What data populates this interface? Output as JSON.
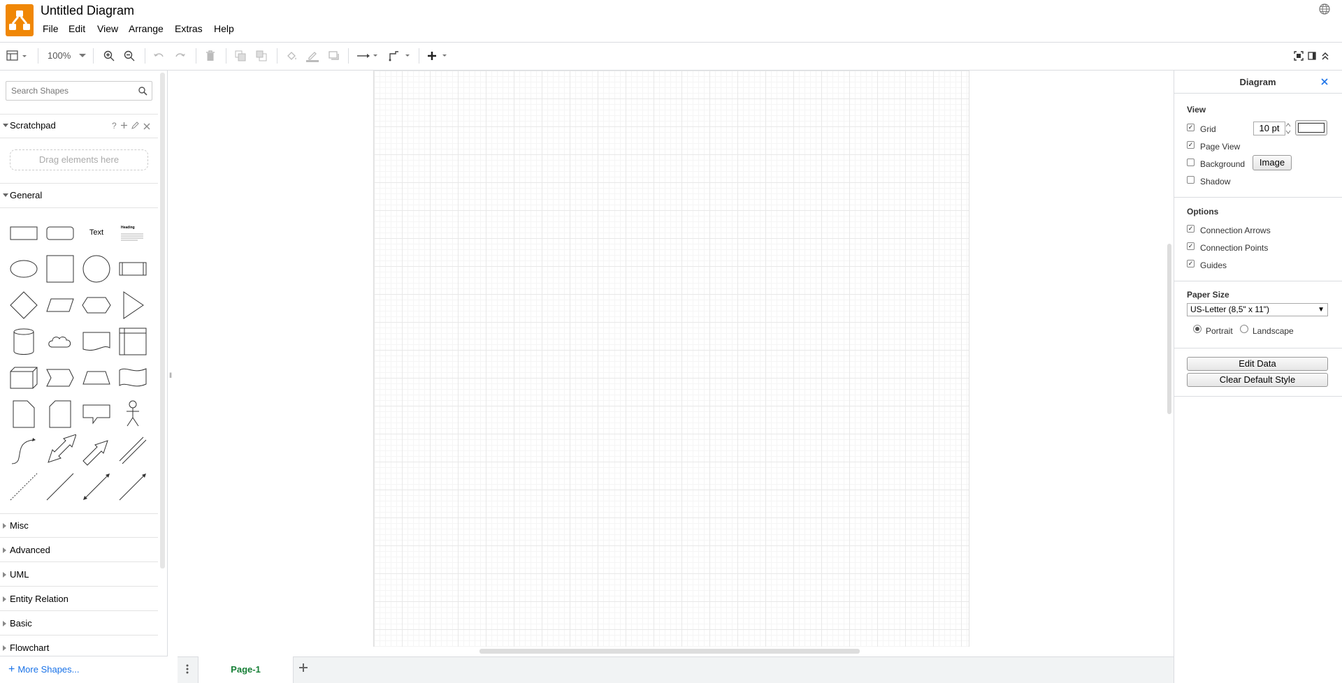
{
  "app": {
    "title": "Untitled Diagram",
    "menu": [
      "File",
      "Edit",
      "View",
      "Arrange",
      "Extras",
      "Help"
    ]
  },
  "toolbar": {
    "zoom": "100%"
  },
  "sidebar": {
    "search_placeholder": "Search Shapes",
    "scratchpad": {
      "label": "Scratchpad",
      "help": "?",
      "drag_hint": "Drag elements here"
    },
    "general_label": "General",
    "shape_text": "Text",
    "shape_heading": "Heading",
    "collapsed_sections": [
      "Misc",
      "Advanced",
      "UML",
      "Entity Relation",
      "Basic",
      "Flowchart"
    ],
    "more_shapes": "More Shapes..."
  },
  "pages": {
    "tabs": [
      "Page-1"
    ]
  },
  "panel": {
    "title": "Diagram",
    "view": {
      "heading": "View",
      "grid_label": "Grid",
      "grid_checked": true,
      "grid_size": "10 pt",
      "page_view_label": "Page View",
      "page_view_checked": true,
      "background_label": "Background",
      "background_checked": false,
      "image_button": "Image",
      "shadow_label": "Shadow",
      "shadow_checked": false
    },
    "options": {
      "heading": "Options",
      "items": [
        {
          "label": "Connection Arrows",
          "checked": true
        },
        {
          "label": "Connection Points",
          "checked": true
        },
        {
          "label": "Guides",
          "checked": true
        }
      ]
    },
    "paper": {
      "heading": "Paper Size",
      "selected": "US-Letter (8,5\" x 11\")",
      "portrait_label": "Portrait",
      "landscape_label": "Landscape",
      "orientation": "Portrait"
    },
    "buttons": {
      "edit_data": "Edit Data",
      "clear_style": "Clear Default Style"
    }
  },
  "colors": {
    "brand": "#f08705",
    "active_tab_text": "#188038",
    "link": "#1a73e8"
  }
}
